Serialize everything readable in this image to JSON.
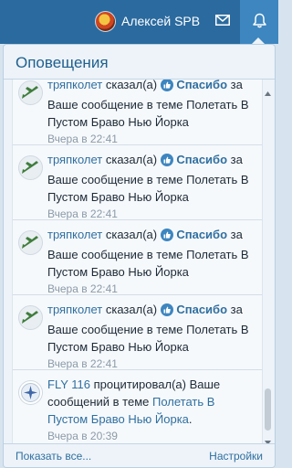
{
  "topbar": {
    "username": "Алексей SPB"
  },
  "icons": {
    "mail": "envelope-icon",
    "bell": "bell-icon",
    "like": "thumbs-up-icon"
  },
  "colors": {
    "topbar": "#2a6a9f",
    "active_tab": "#3d86c0",
    "link": "#2f6f9f"
  },
  "dropdown": {
    "title": "Оповещения",
    "show_all": "Показать все...",
    "settings": "Настройки",
    "notifications": [
      {
        "author": "тряпколет",
        "action": "сказал(а)",
        "like_label": "Спасибо",
        "rest": "за Ваше сообщение в теме Полетать В Пустом Браво Нью Йорка",
        "time": "Вчера в 22:41"
      },
      {
        "author": "тряпколет",
        "action": "сказал(а)",
        "like_label": "Спасибо",
        "rest": "за Ваше сообщение в теме Полетать В Пустом Браво Нью Йорка",
        "time": "Вчера в 22:41"
      },
      {
        "author": "тряпколет",
        "action": "сказал(а)",
        "like_label": "Спасибо",
        "rest": "за Ваше сообщение в теме Полетать В Пустом Браво Нью Йорка",
        "time": "Вчера в 22:41"
      },
      {
        "author": "тряпколет",
        "action": "сказал(а)",
        "like_label": "Спасибо",
        "rest": "за Ваше сообщение в теме Полетать В Пустом Браво Нью Йорка",
        "time": "Вчера в 22:41"
      }
    ],
    "quote_notification": {
      "author": "FLY 116",
      "action": "процитировал(а) Ваше сообщений в теме",
      "thread": "Полетать В Пустом Браво Нью Йорка",
      "suffix": ".",
      "time": "Вчера в 20:39"
    }
  }
}
